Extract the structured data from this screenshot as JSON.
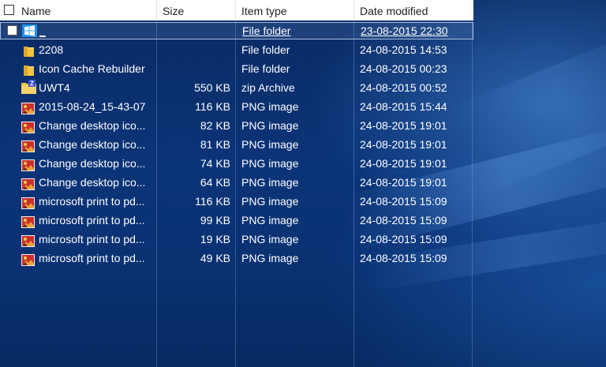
{
  "columns": {
    "name": "Name",
    "size": "Size",
    "type": "Item type",
    "date": "Date modified"
  },
  "rows": [
    {
      "icon": "windows-logo-icon",
      "name": "_",
      "size": "",
      "type": "File folder",
      "date": "23-08-2015 22:30",
      "selected": true
    },
    {
      "icon": "folder-icon",
      "name": "2208",
      "size": "",
      "type": "File folder",
      "date": "24-08-2015 14:53"
    },
    {
      "icon": "folder-icon",
      "name": "Icon Cache Rebuilder",
      "size": "",
      "type": "File folder",
      "date": "24-08-2015 00:23"
    },
    {
      "icon": "zip-archive-icon",
      "name": "UWT4",
      "size": "550 KB",
      "type": "zip Archive",
      "date": "24-08-2015 00:52"
    },
    {
      "icon": "png-image-icon",
      "name": "2015-08-24_15-43-07",
      "size": "116 KB",
      "type": "PNG image",
      "date": "24-08-2015 15:44"
    },
    {
      "icon": "png-image-icon",
      "name": "Change desktop ico...",
      "size": "82 KB",
      "type": "PNG image",
      "date": "24-08-2015 19:01"
    },
    {
      "icon": "png-image-icon",
      "name": "Change desktop ico...",
      "size": "81 KB",
      "type": "PNG image",
      "date": "24-08-2015 19:01"
    },
    {
      "icon": "png-image-icon",
      "name": "Change desktop ico...",
      "size": "74 KB",
      "type": "PNG image",
      "date": "24-08-2015 19:01"
    },
    {
      "icon": "png-image-icon",
      "name": "Change desktop ico...",
      "size": "64 KB",
      "type": "PNG image",
      "date": "24-08-2015 19:01"
    },
    {
      "icon": "png-image-icon",
      "name": "microsoft print to pd...",
      "size": "116 KB",
      "type": "PNG image",
      "date": "24-08-2015 15:09"
    },
    {
      "icon": "png-image-icon",
      "name": "microsoft print to pd...",
      "size": "99 KB",
      "type": "PNG image",
      "date": "24-08-2015 15:09"
    },
    {
      "icon": "png-image-icon",
      "name": "microsoft print to pd...",
      "size": "19 KB",
      "type": "PNG image",
      "date": "24-08-2015 15:09"
    },
    {
      "icon": "png-image-icon",
      "name": "microsoft print to pd...",
      "size": "49 KB",
      "type": "PNG image",
      "date": "24-08-2015 15:09"
    }
  ],
  "colors": {
    "accent_selection": "#a8bde0",
    "folder": "#f5c342",
    "header_bg": "#ffffff",
    "desktop_bg": "#0a2a63"
  }
}
